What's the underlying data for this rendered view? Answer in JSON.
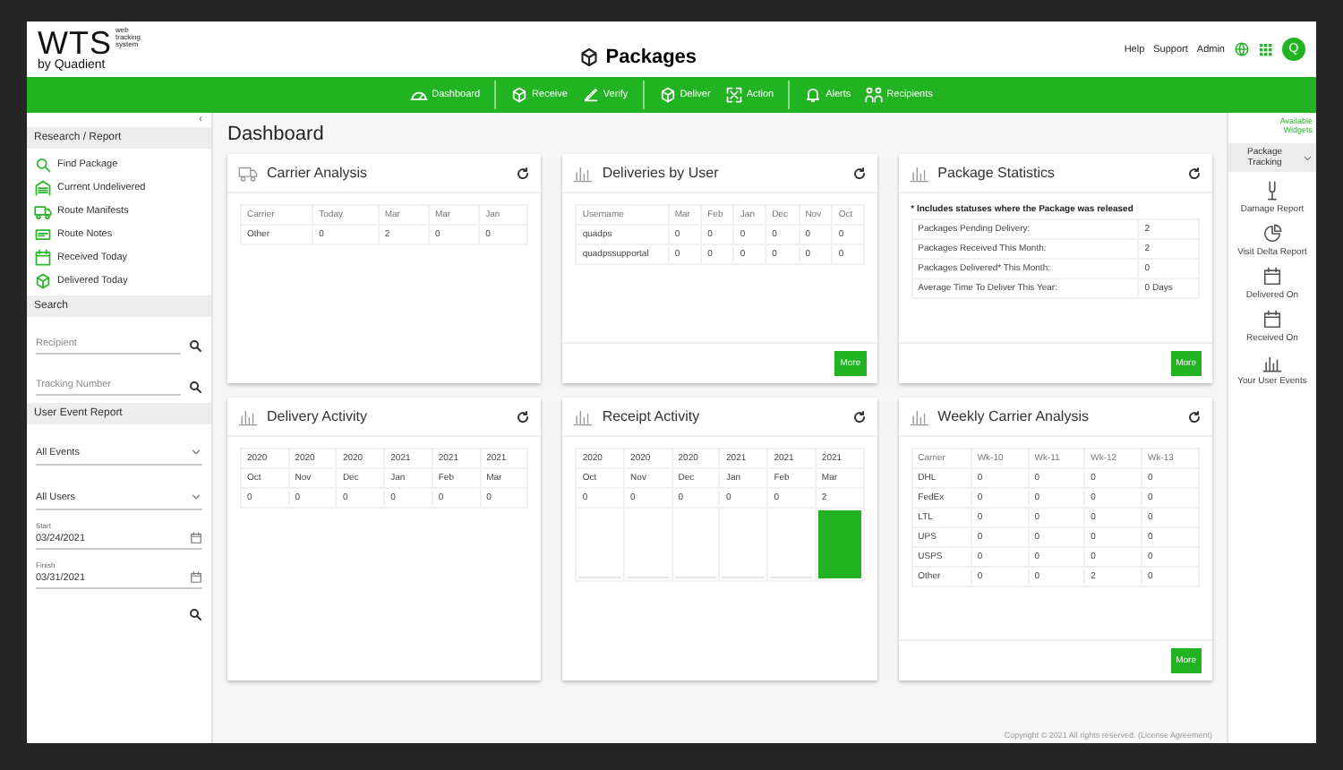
{
  "header": {
    "logo": "WTS",
    "logo_tagline": "web tracking system",
    "logo_by": "by Quadient",
    "title": "Packages",
    "links": [
      "Help",
      "Support",
      "Admin"
    ],
    "avatar": "Q"
  },
  "nav": [
    [
      "Dashboard"
    ],
    [
      "Receive",
      "Verify"
    ],
    [
      "Deliver",
      "Action"
    ],
    [
      "Alerts",
      "Recipients"
    ]
  ],
  "sidebar": {
    "collapse": "‹",
    "research": {
      "title": "Research / Report",
      "links": [
        "Find Package",
        "Current Undelivered",
        "Route Manifests",
        "Route Notes",
        "Received Today",
        "Delivered Today"
      ]
    },
    "search": {
      "title": "Search",
      "fields": [
        {
          "placeholder": "Recipient"
        },
        {
          "placeholder": "Tracking Number"
        }
      ]
    },
    "user_event_report": {
      "title": "User Event Report",
      "selects": [
        "All Events",
        "All Users"
      ],
      "dates": [
        {
          "label": "Start",
          "value": "03/24/2021"
        },
        {
          "label": "Finish",
          "value": "03/31/2021"
        }
      ]
    }
  },
  "main": {
    "title": "Dashboard",
    "cards": [
      {
        "title": "Carrier Analysis",
        "header": [
          "Carrier",
          "Today",
          "Mar",
          "Mar",
          "Jan"
        ],
        "rows": [
          [
            "Other",
            "0",
            "2",
            "0",
            "0"
          ]
        ]
      },
      {
        "title": "Deliveries by User",
        "header": [
          "Username",
          "Mar",
          "Feb",
          "Jan",
          "Dec",
          "Nov",
          "Oct"
        ],
        "rows": [
          [
            "quadps",
            "0",
            "0",
            "0",
            "0",
            "0",
            "0"
          ],
          [
            "quadpssupportal",
            "0",
            "0",
            "0",
            "0",
            "0",
            "0"
          ]
        ],
        "more": "More"
      },
      {
        "title": "Package Statistics",
        "note": "* Includes statuses where the Package was released",
        "rows": [
          [
            "Packages Pending Delivery:",
            "2"
          ],
          [
            "Packages Received This Month:",
            "2"
          ],
          [
            "Packages Delivered* This Month:",
            "0"
          ],
          [
            "Average Time To Deliver This Year:",
            "0 Days"
          ]
        ],
        "more": "More"
      },
      {
        "title": "Delivery Activity",
        "rows": [
          [
            "2020",
            "2020",
            "2020",
            "2021",
            "2021",
            "2021"
          ],
          [
            "Oct",
            "Nov",
            "Dec",
            "Jan",
            "Feb",
            "Mar"
          ],
          [
            "0",
            "0",
            "0",
            "0",
            "0",
            "0"
          ]
        ]
      },
      {
        "title": "Receipt Activity",
        "rows": [
          [
            "2020",
            "2020",
            "2020",
            "2021",
            "2021",
            "2021"
          ],
          [
            "Oct",
            "Nov",
            "Dec",
            "Jan",
            "Feb",
            "Mar"
          ],
          [
            "0",
            "0",
            "0",
            "0",
            "0",
            "2"
          ]
        ],
        "bars": [
          {
            "level": 0
          },
          {
            "level": 0
          },
          {
            "level": 0
          },
          {
            "level": 0
          },
          {
            "level": 0
          },
          {
            "level": 1
          }
        ]
      },
      {
        "title": "Weekly Carrier Analysis",
        "header": [
          "Carrier",
          "Wk-10",
          "Wk-11",
          "Wk-12",
          "Wk-13"
        ],
        "rows": [
          [
            "DHL",
            "0",
            "0",
            "0",
            "0"
          ],
          [
            "FedEx",
            "0",
            "0",
            "0",
            "0"
          ],
          [
            "LTL",
            "0",
            "0",
            "0",
            "0"
          ],
          [
            "UPS",
            "0",
            "0",
            "0",
            "0"
          ],
          [
            "USPS",
            "0",
            "0",
            "0",
            "0"
          ],
          [
            "Other",
            "0",
            "0",
            "2",
            "0"
          ]
        ],
        "more": "More"
      }
    ],
    "footer": {
      "text": "Copyright © 2021 All rights reserved.",
      "link": "(License Agreement)"
    }
  },
  "widgets": {
    "available": "Available Widgets",
    "dropdown": "Package Tracking",
    "items": [
      "Damage Report",
      "Visit Delta Report",
      "Delivered On",
      "Received On",
      "Your User Events"
    ]
  }
}
